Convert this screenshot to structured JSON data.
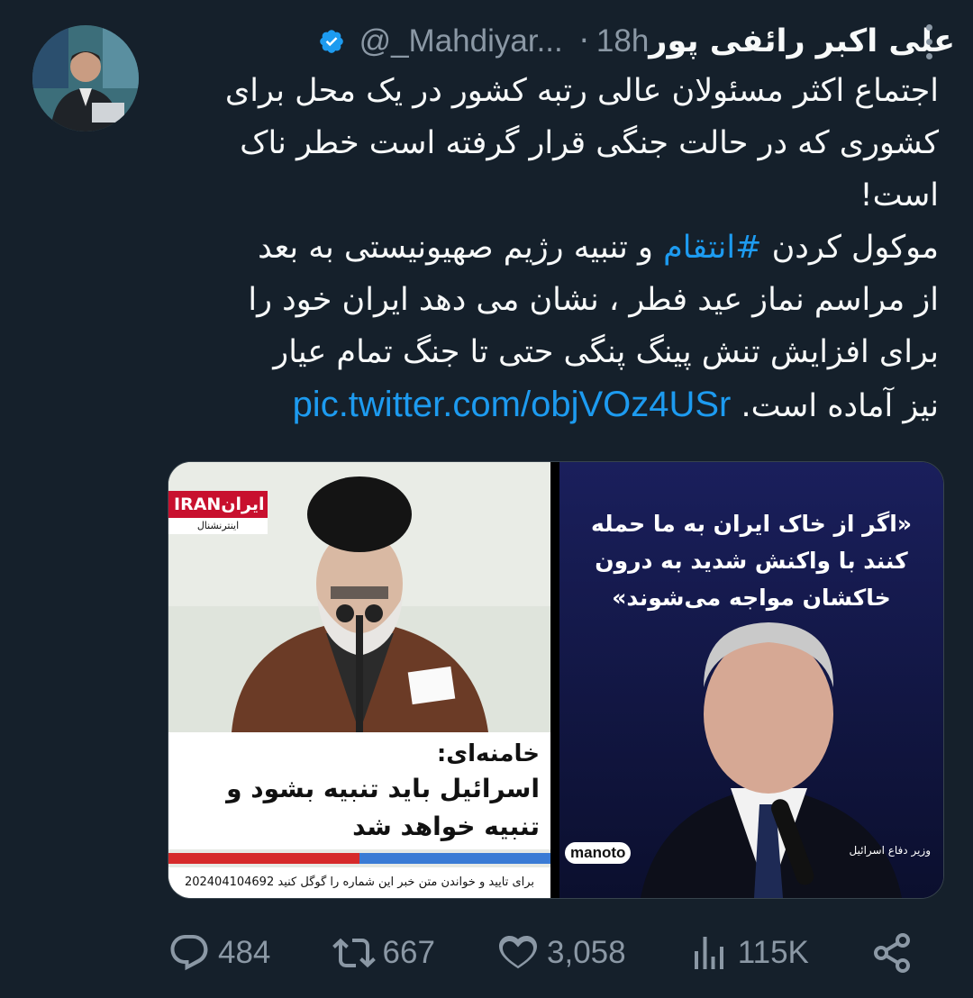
{
  "tweet": {
    "author_name": "علی اکبر رائفی پور",
    "handle": "@_Mahdiyar...",
    "time": "18h",
    "text_lines": [
      "اجتماع اکثر مسئولان عالی رتبه کشور در یک محل برای",
      "کشوری که در حالت جنگی قرار گرفته است خطر ناک",
      "است!"
    ],
    "text2_before": "موکول کردن ",
    "hashtag": "#انتقام",
    "text2_after": " و تنبیه رژیم صهیونیستی به بعد",
    "text_lines_2": [
      "از مراسم نماز عید فطر ، نشان می دهد ایران  خود را",
      "برای افزایش تنش پینگ پنگی حتی تا جنگ تمام عیار"
    ],
    "last_line_text": "نیز آماده است.",
    "link": "pic.twitter.com/objVOz4USr"
  },
  "media": {
    "left": {
      "logo_latin": "IRAN",
      "logo_farsi": "ایران",
      "logo_sub": "اینترنشنال",
      "caption_line1": "خامنه‌ای:",
      "caption_line2": "اسرائیل باید تنبیه بشود و",
      "caption_line3": "تنبیه خواهد شد",
      "verify_text": "برای تایید و خواندن متن خبر این شماره را گوگل کنید 202404104692"
    },
    "right": {
      "quote_line1": "«اگر از خاک ایران به ما حمله",
      "quote_line2": "کنند با واکنش شدید به درون",
      "quote_line3": "خاکشان مواجه می‌شوند»",
      "brand": "manoto",
      "label": "وزیر دفاع اسرائیل"
    }
  },
  "actions": {
    "replies": "484",
    "retweets": "667",
    "likes": "3,058",
    "views": "115K"
  },
  "colors": {
    "background": "#15202b",
    "accent": "#1d9bf0",
    "secondary_text": "#8b98a5"
  },
  "icons": [
    "verified-badge-icon",
    "more-icon",
    "reply-icon",
    "retweet-icon",
    "like-icon",
    "views-icon",
    "share-icon"
  ]
}
